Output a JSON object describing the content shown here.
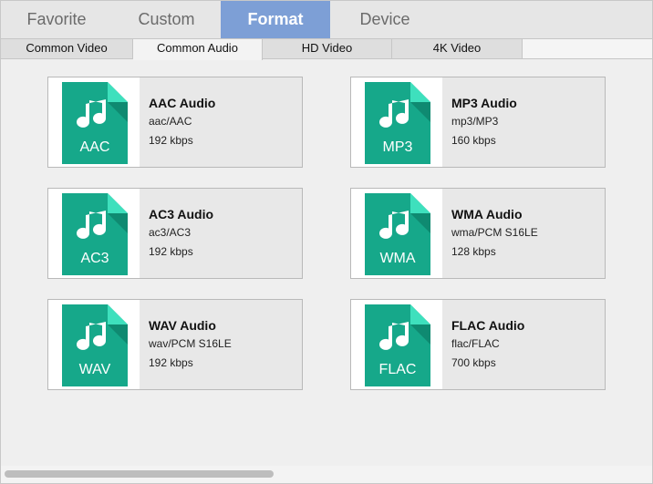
{
  "main_tabs": [
    {
      "label": "Favorite"
    },
    {
      "label": "Custom"
    },
    {
      "label": "Format"
    },
    {
      "label": "Device"
    }
  ],
  "sub_tabs": [
    {
      "label": "Common Video"
    },
    {
      "label": "Common Audio"
    },
    {
      "label": "HD Video"
    },
    {
      "label": "4K Video"
    }
  ],
  "formats": [
    {
      "ext": "AAC",
      "name": "AAC Audio",
      "codec": "aac/AAC",
      "bitrate": "192 kbps"
    },
    {
      "ext": "MP3",
      "name": "MP3 Audio",
      "codec": "mp3/MP3",
      "bitrate": "160 kbps"
    },
    {
      "ext": "AC3",
      "name": "AC3 Audio",
      "codec": "ac3/AC3",
      "bitrate": "192 kbps"
    },
    {
      "ext": "WMA",
      "name": "WMA Audio",
      "codec": "wma/PCM S16LE",
      "bitrate": "128 kbps"
    },
    {
      "ext": "WAV",
      "name": "WAV Audio",
      "codec": "wav/PCM S16LE",
      "bitrate": "192 kbps"
    },
    {
      "ext": "FLAC",
      "name": "FLAC Audio",
      "codec": "flac/FLAC",
      "bitrate": "700 kbps"
    }
  ],
  "icons": {
    "format": "music-note-file-icon"
  },
  "colors": {
    "accent": "#7d9fd6",
    "icon_green": "#16a88a",
    "icon_fold": "#3ee0bd"
  }
}
